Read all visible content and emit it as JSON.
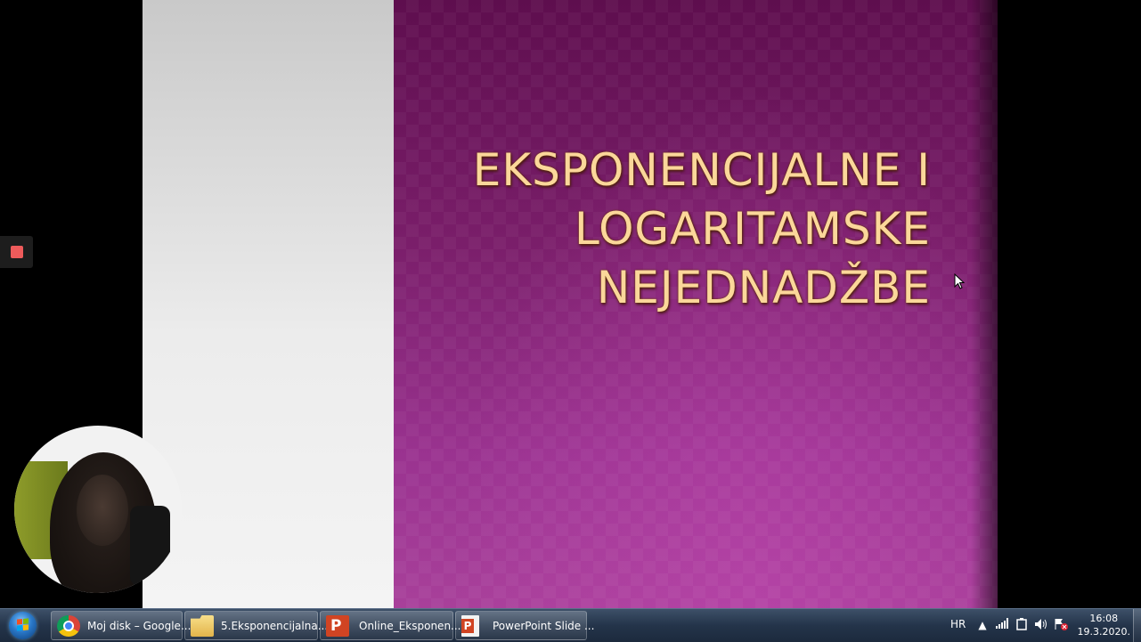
{
  "slide": {
    "title_lines": [
      "EKSPONENCIJALNE I",
      "LOGARITAMSKE",
      "NEJEDNADŽBE"
    ],
    "title_color": "#fbd79a",
    "background_color": "#7a1e6a"
  },
  "recorder": {
    "stop_icon": "stop-square-icon",
    "color": "#ee5b5b"
  },
  "webcam": {
    "icon": "webcam-overlay"
  },
  "taskbar": {
    "start_icon": "windows-start-icon",
    "tasks": [
      {
        "label": "Moj disk – Google...",
        "icon": "chrome-icon"
      },
      {
        "label": "5.Eksponencijalna...",
        "icon": "folder-icon"
      },
      {
        "label": "Online_Eksponen...",
        "icon": "powerpoint-icon"
      },
      {
        "label": "PowerPoint Slide ...",
        "icon": "powerpoint-slideshow-icon"
      }
    ],
    "tray": {
      "language": "HR",
      "time": "16:08",
      "date": "19.3.2020."
    }
  }
}
